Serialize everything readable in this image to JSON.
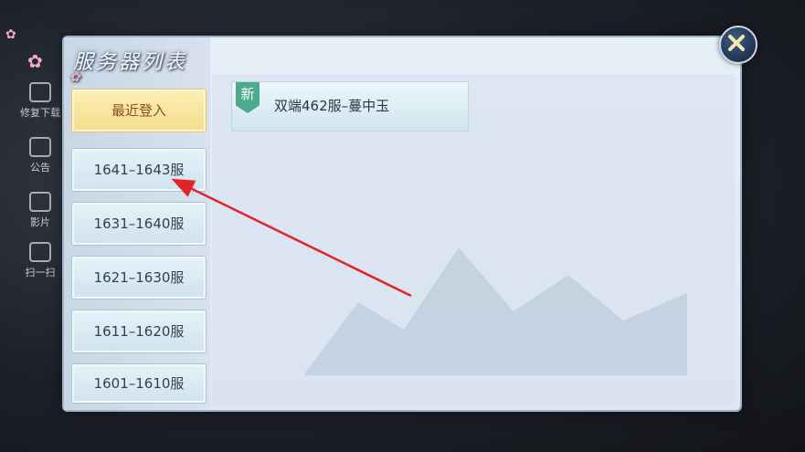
{
  "background": {
    "side_items": [
      {
        "label": "修复下载",
        "icon": "wrench-icon"
      },
      {
        "label": "公告",
        "icon": "notice-icon"
      },
      {
        "label": "影片",
        "icon": "film-icon"
      },
      {
        "label": "扫一扫",
        "icon": "scan-icon"
      }
    ]
  },
  "panel": {
    "title": "服务器列表",
    "recent_label": "最近登入",
    "server_groups": [
      "1641–1643服",
      "1631–1640服",
      "1621–1630服",
      "1611–1620服",
      "1601–1610服"
    ],
    "selected_group": "1641–1643服",
    "servers": [
      {
        "badge": "新",
        "name": "双端462服–蔓中玉"
      }
    ]
  },
  "colors": {
    "recent_button": "#f5dd8c",
    "badge": "#4eaa8c",
    "annotation_arrow": "#e0242a"
  },
  "icons": {
    "close": "close-icon",
    "badge": "new-badge-icon"
  }
}
